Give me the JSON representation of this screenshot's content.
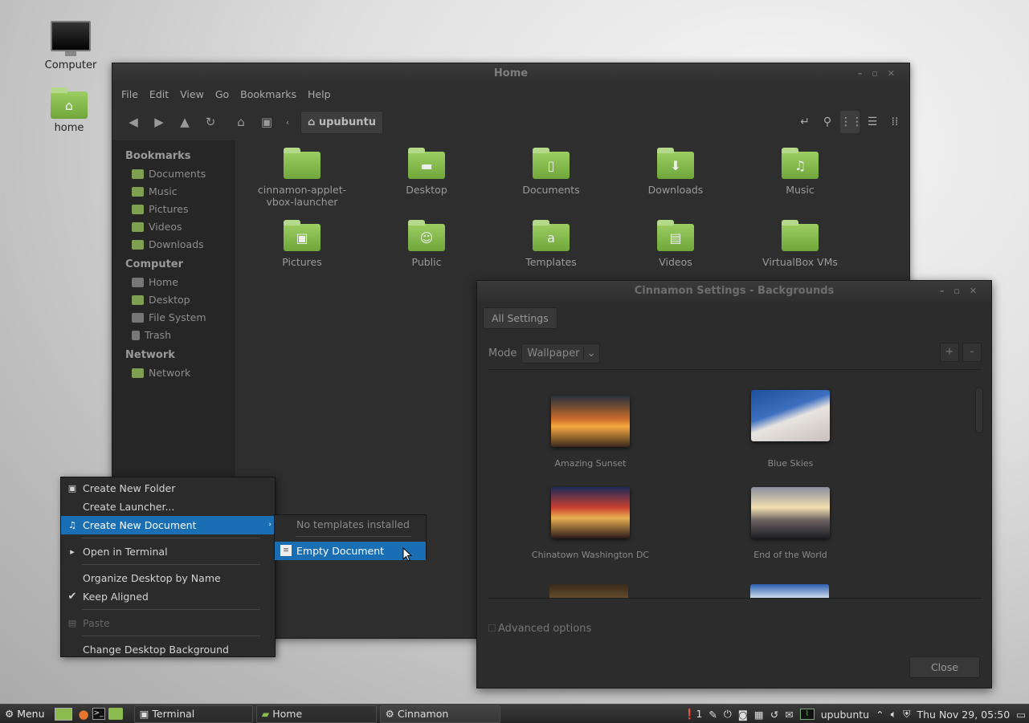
{
  "desktop": {
    "icons": [
      {
        "label": "Computer"
      },
      {
        "label": "home"
      }
    ]
  },
  "file_manager": {
    "title": "Home",
    "menu": [
      "File",
      "Edit",
      "View",
      "Go",
      "Bookmarks",
      "Help"
    ],
    "location": "upubuntu",
    "sidebar": {
      "sections": [
        {
          "title": "Bookmarks",
          "items": [
            "Documents",
            "Music",
            "Pictures",
            "Videos",
            "Downloads"
          ]
        },
        {
          "title": "Computer",
          "items": [
            "Home",
            "Desktop",
            "File System",
            "Trash"
          ]
        },
        {
          "title": "Network",
          "items": [
            "Network"
          ]
        }
      ]
    },
    "files": [
      {
        "name": "cinnamon-applet-vbox-launcher",
        "icon": "folder-icon"
      },
      {
        "name": "Desktop",
        "icon": "desktop-folder-icon"
      },
      {
        "name": "Documents",
        "icon": "documents-folder-icon"
      },
      {
        "name": "Downloads",
        "icon": "downloads-folder-icon"
      },
      {
        "name": "Music",
        "icon": "music-folder-icon"
      },
      {
        "name": "Pictures",
        "icon": "pictures-folder-icon"
      },
      {
        "name": "Public",
        "icon": "public-folder-icon"
      },
      {
        "name": "Templates",
        "icon": "templates-folder-icon"
      },
      {
        "name": "Videos",
        "icon": "videos-folder-icon"
      },
      {
        "name": "VirtualBox VMs",
        "icon": "folder-icon"
      }
    ]
  },
  "settings_window": {
    "title": "Cinnamon Settings - Backgrounds",
    "all_settings_label": "All Settings",
    "mode_label": "Mode",
    "mode_value": "Wallpaper",
    "add_label": "+",
    "remove_label": "-",
    "wallpapers": [
      {
        "name": "Amazing Sunset",
        "colors": [
          "#f0a030",
          "#2a2f3a"
        ]
      },
      {
        "name": "Blue Skies",
        "colors": [
          "#1d4f9e",
          "#e8e4e0"
        ]
      },
      {
        "name": "Chinatown Washington DC",
        "colors": [
          "#3a2020",
          "#c94030"
        ]
      },
      {
        "name": "End of the World",
        "colors": [
          "#f2e0b0",
          "#1c1c22"
        ]
      }
    ],
    "advanced_label": "Advanced options",
    "close_label": "Close"
  },
  "context_menu": {
    "items": [
      {
        "label": "Create New Folder"
      },
      {
        "label": "Create Launcher..."
      },
      {
        "label": "Create New Document"
      },
      {
        "label": "Open in Terminal"
      },
      {
        "label": "Organize Desktop by Name"
      },
      {
        "label": "Keep Aligned",
        "checked": true
      },
      {
        "label": "Paste",
        "disabled": true
      },
      {
        "label": "Change Desktop Background"
      }
    ],
    "submenu": {
      "items": [
        {
          "label": "No templates installed",
          "disabled": true
        },
        {
          "label": "Empty Document"
        }
      ]
    }
  },
  "taskbar": {
    "menu_label": "Menu",
    "windows": [
      "Terminal",
      "Home",
      "Cinnamon Settings..."
    ],
    "notification_count": "1",
    "user": "upubuntu",
    "clock": "Thu Nov 29, 05:50"
  },
  "colors": {
    "highlight": "#1a6eb4",
    "folder_green": "#8cc152"
  }
}
